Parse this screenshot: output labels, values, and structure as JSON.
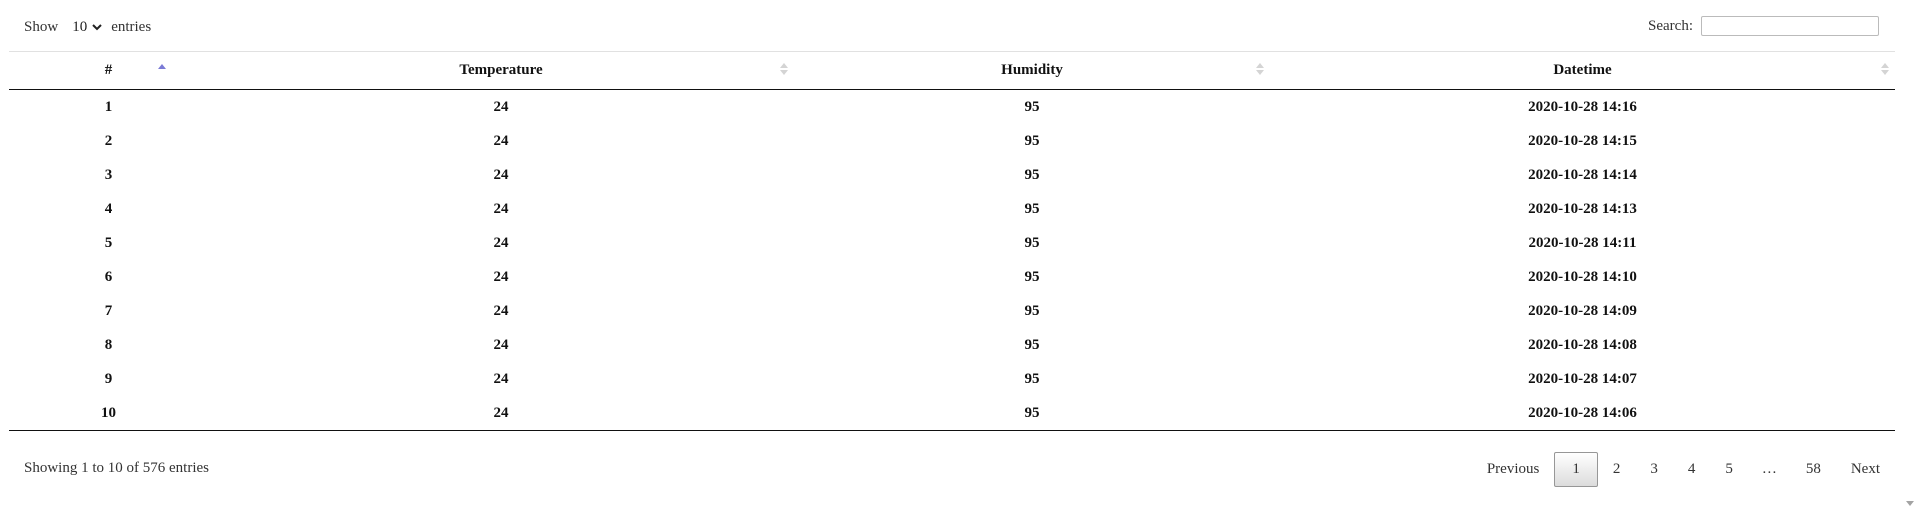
{
  "length": {
    "show_label": "Show",
    "selected": "10",
    "entries_label": "entries"
  },
  "search": {
    "label": "Search:",
    "value": ""
  },
  "table": {
    "headers": [
      "#",
      "Temperature",
      "Humidity",
      "Datetime"
    ],
    "rows": [
      [
        "1",
        "24",
        "95",
        "2020-10-28 14:16"
      ],
      [
        "2",
        "24",
        "95",
        "2020-10-28 14:15"
      ],
      [
        "3",
        "24",
        "95",
        "2020-10-28 14:14"
      ],
      [
        "4",
        "24",
        "95",
        "2020-10-28 14:13"
      ],
      [
        "5",
        "24",
        "95",
        "2020-10-28 14:11"
      ],
      [
        "6",
        "24",
        "95",
        "2020-10-28 14:10"
      ],
      [
        "7",
        "24",
        "95",
        "2020-10-28 14:09"
      ],
      [
        "8",
        "24",
        "95",
        "2020-10-28 14:08"
      ],
      [
        "9",
        "24",
        "95",
        "2020-10-28 14:07"
      ],
      [
        "10",
        "24",
        "95",
        "2020-10-28 14:06"
      ]
    ]
  },
  "info": "Showing 1 to 10 of 576 entries",
  "pagination": {
    "previous": "Previous",
    "pages": [
      "1",
      "2",
      "3",
      "4",
      "5"
    ],
    "ellipsis": "…",
    "last": "58",
    "next": "Next",
    "current": "1"
  },
  "colors": {
    "sort_active": "#7b7bd6",
    "sort_inactive": "#d4d4d4"
  }
}
